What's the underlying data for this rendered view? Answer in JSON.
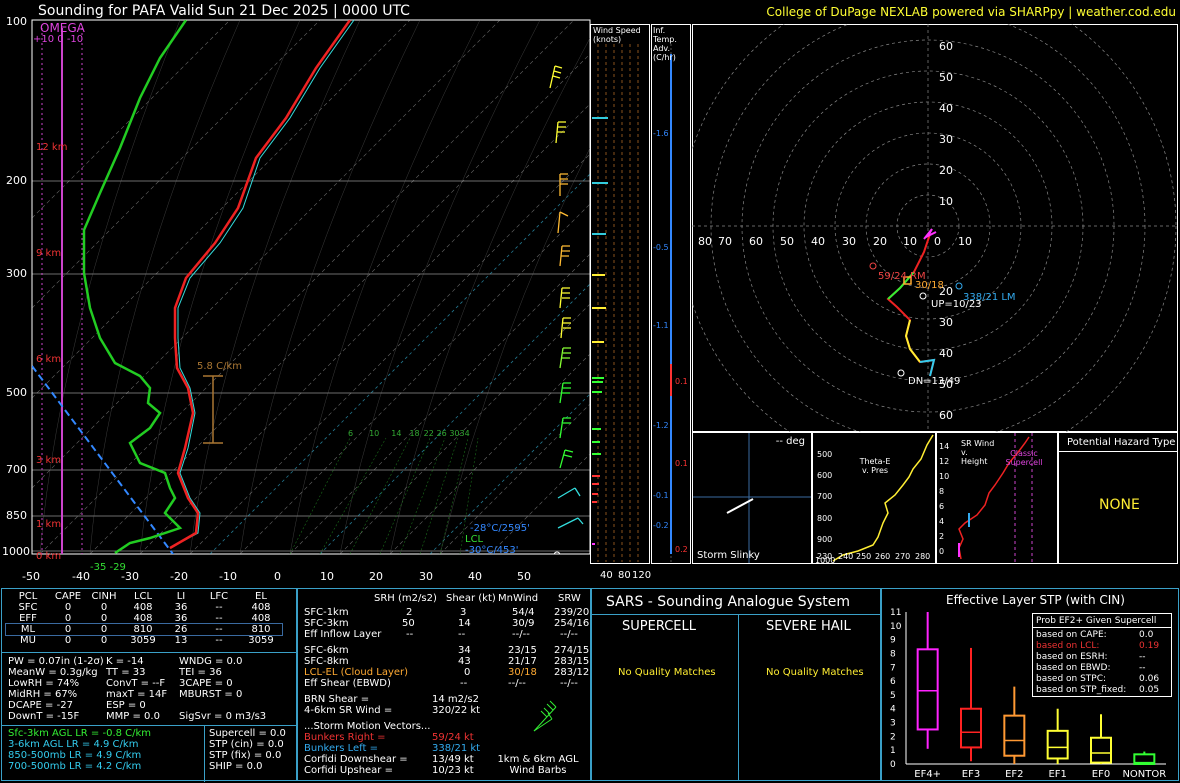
{
  "header": {
    "title": "Sounding for PAFA Valid  Sun 21 Dec 2025 | 0000 UTC",
    "credit": "College of DuPage NEXLAB powered via SHARPpy | weather.cod.edu"
  },
  "skewt": {
    "pressure_ticks": [
      "100",
      "200",
      "300",
      "500",
      "700",
      "850",
      "1000"
    ],
    "temp_ticks": [
      "-50",
      "-40",
      "-30",
      "-20",
      "-10",
      "0",
      "10",
      "20",
      "30",
      "40",
      "50"
    ],
    "height_labels": [
      "12 km",
      "9 km",
      "6 km",
      "3 km",
      "1 km",
      "0 km"
    ],
    "omega_label": "OMEGA",
    "omega_scale": "+10  0  -10",
    "lapse_label": "5.8 C/km",
    "lcl_label": "LCL",
    "lcl_value": "-28°C/2595'",
    "frz_value": "-30°C/453'",
    "sfc_temps": "-35 -29",
    "mixing_ratios": [
      "6",
      "10",
      "14",
      "18",
      "22",
      "26",
      "30",
      "34"
    ]
  },
  "wind_speed_panel": {
    "title": "Wind Speed (knots)",
    "ticks": [
      "40",
      "80",
      "120"
    ]
  },
  "temp_adv_panel": {
    "title": "Inf. Temp. Adv. (C/hr)",
    "values": [
      "-1.6",
      "-0.5",
      "-1.1",
      "0.1",
      "-1.2",
      "0.1",
      "-0.1",
      "-0.2",
      "0.2"
    ]
  },
  "hodograph": {
    "rings_y": [
      "60",
      "50",
      "40",
      "30",
      "20",
      "10"
    ],
    "rings_y_bottom": [
      "20",
      "30",
      "40",
      "50",
      "60"
    ],
    "rings_x": [
      "80",
      "70",
      "60",
      "50",
      "40",
      "30",
      "20",
      "10",
      "0",
      "10"
    ],
    "rm_label": "59/24 RM",
    "lm_label": "338/21 LM",
    "up_label": "UP=10/23",
    "dn_label": "DN=13/49",
    "mean_label": "30/18"
  },
  "storm_slinky": {
    "label": "Storm Slinky",
    "deg": "-- deg"
  },
  "theta_e": {
    "title": "Theta-E v. Pres",
    "y_ticks": [
      "500",
      "600",
      "700",
      "800",
      "900",
      "1000"
    ],
    "x_ticks": [
      "230",
      "240",
      "250",
      "260",
      "270",
      "280"
    ]
  },
  "srwind": {
    "title": "SR Wind v. Height",
    "y_ticks": [
      "14",
      "12",
      "10",
      "8",
      "6",
      "4",
      "2",
      "0"
    ],
    "label": "Classic Supercell"
  },
  "hazard": {
    "title": "Potential Hazard Type",
    "value": "NONE"
  },
  "parcels": {
    "headers": [
      "PCL",
      "CAPE",
      "CINH",
      "LCL",
      "LI",
      "LFC",
      "EL"
    ],
    "rows": [
      [
        "SFC",
        "0",
        "0",
        "408",
        "36",
        "--",
        "408"
      ],
      [
        "EFF",
        "0",
        "0",
        "408",
        "36",
        "--",
        "408"
      ],
      [
        "ML",
        "0",
        "0",
        "810",
        "26",
        "--",
        "810"
      ],
      [
        "MU",
        "0",
        "0",
        "3059",
        "13",
        "--",
        "3059"
      ]
    ]
  },
  "indices": {
    "col1": [
      "PW = 0.07in (1-2σ)",
      "MeanW = 0.3g/kg",
      "LowRH = 74%",
      "MidRH = 67%",
      "DCAPE = -27",
      "DownT = -15F"
    ],
    "col2": [
      "K = -14",
      "TT = 33",
      "ConvT = --F",
      "maxT = 14F",
      "ESP = 0",
      "MMP = 0.0"
    ],
    "col3": [
      "WNDG = 0.0",
      "TEI = 36",
      "3CAPE = 0",
      "MBURST = 0",
      "",
      "SigSvr = 0 m3/s3"
    ]
  },
  "lapse": [
    "Sfc-3km AGL LR = -0.8 C/km",
    "3-6km AGL LR = 4.9 C/km",
    "850-500mb LR = 4.9 C/km",
    "700-500mb LR = 4.2 C/km"
  ],
  "composites": [
    "Supercell = 0.0",
    "STP (cin) = 0.0",
    "STP (fix) = 0.0",
    "SHIP = 0.0"
  ],
  "kinematics": {
    "headers": [
      "SRH (m2/s2)",
      "Shear (kt)",
      "MnWind",
      "SRW"
    ],
    "rows": [
      [
        "SFC-1km",
        "2",
        "3",
        "54/4",
        "239/20"
      ],
      [
        "SFC-3km",
        "50",
        "14",
        "30/9",
        "254/16"
      ],
      [
        "Eff Inflow Layer",
        "--",
        "--",
        "--/--",
        "--/--"
      ],
      [
        "SFC-6km",
        "34",
        "23/15",
        "274/15",
        ""
      ],
      [
        "SFC-8km",
        "43",
        "21/17",
        "283/15",
        ""
      ],
      [
        "LCL-EL (Cloud Layer)",
        "0",
        "30/18",
        "283/12",
        ""
      ],
      [
        "Eff Shear (EBWD)",
        "--",
        "--/--",
        "--/--",
        ""
      ]
    ],
    "brn_label": "BRN Shear =",
    "brn_value": "14 m2/s2",
    "srw_label": "4-6km SR Wind =",
    "srw_value": "320/22 kt",
    "sm_title": "...Storm Motion Vectors...",
    "sm_rows": [
      [
        "Bunkers Right =",
        "59/24 kt"
      ],
      [
        "Bunkers Left =",
        "338/21 kt"
      ],
      [
        "Corfidi Downshear =",
        "13/49 kt"
      ],
      [
        "Corfidi Upshear =",
        "10/23 kt"
      ]
    ],
    "barbs_note": "1km & 6km AGL Wind Barbs"
  },
  "sars": {
    "title": "SARS - Sounding Analogue System",
    "supercell": "SUPERCELL",
    "hail": "SEVERE HAIL",
    "no_match": "No Quality Matches"
  },
  "stp": {
    "title": "Effective Layer STP (with CIN)",
    "prob_title": "Prob EF2+ Given Supercell",
    "prob_rows": [
      [
        "based on CAPE:",
        "0.0"
      ],
      [
        "based on LCL:",
        "0.19"
      ],
      [
        "based on ESRH:",
        "--"
      ],
      [
        "based on EBWD:",
        "--"
      ],
      [
        "based on STPC:",
        "0.06"
      ],
      [
        "based on STP_fixed:",
        "0.05"
      ]
    ]
  },
  "chart_data": {
    "type": "box",
    "title": "Effective Layer STP (with CIN)",
    "categories": [
      "EF4+",
      "EF3",
      "EF2",
      "EF1",
      "EF0",
      "NONTOR"
    ],
    "y_ticks": [
      "11",
      "10",
      "9",
      "8",
      "7",
      "6",
      "5",
      "4",
      "3",
      "2",
      "1",
      "0"
    ],
    "ylim": [
      0,
      11
    ],
    "colors": [
      "#ff22ff",
      "#ff2222",
      "#ff9933",
      "#ffff33",
      "#ffff33",
      "#33ff33"
    ],
    "boxes": [
      {
        "low": 1.1,
        "q1": 2.5,
        "median": 5.3,
        "q3": 8.3,
        "high": 11.0
      },
      {
        "low": 0.2,
        "q1": 1.2,
        "median": 2.3,
        "q3": 4.0,
        "high": 8.4
      },
      {
        "low": 0.0,
        "q1": 0.6,
        "median": 1.7,
        "q3": 3.5,
        "high": 5.6
      },
      {
        "low": 0.0,
        "q1": 0.4,
        "median": 1.2,
        "q3": 2.4,
        "high": 4.0
      },
      {
        "low": 0.0,
        "q1": 0.1,
        "median": 0.8,
        "q3": 1.9,
        "high": 3.6
      },
      {
        "low": 0.0,
        "q1": 0.0,
        "median": 0.1,
        "q3": 0.7,
        "high": 0.9
      }
    ]
  }
}
